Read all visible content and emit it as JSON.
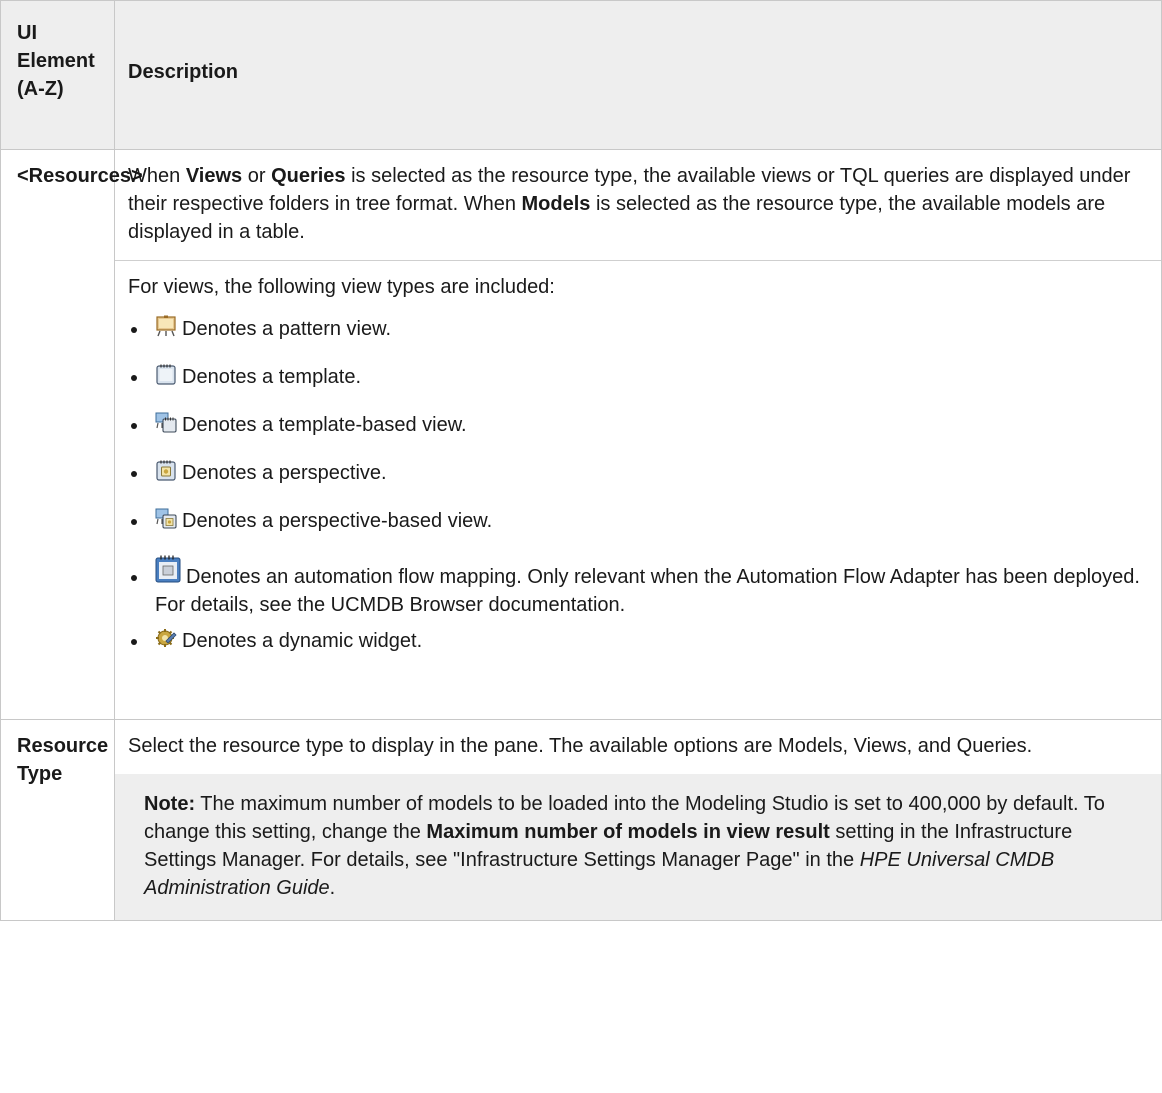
{
  "header": {
    "col1": "UI Element (A-Z)",
    "col2": "Description"
  },
  "rows": [
    {
      "element": "<Resources>",
      "desc_intro": {
        "t1": "When ",
        "b1": "Views",
        "t2": " or ",
        "b2": "Queries",
        "t3": " is selected as the resource type, the available views or TQL queries are displayed under their respective folders in tree format. When ",
        "b3": "Models",
        "t4": " is selected as the resource type, the available models are displayed in a table."
      },
      "desc_types_intro": "For views, the following view types are included:",
      "view_types": [
        {
          "icon": "pattern-view-icon",
          "text": "Denotes a pattern view."
        },
        {
          "icon": "template-icon",
          "text": "Denotes a template."
        },
        {
          "icon": "template-based-view-icon",
          "text": "Denotes a template-based view."
        },
        {
          "icon": "perspective-icon",
          "text": "Denotes a perspective."
        },
        {
          "icon": "perspective-based-view-icon",
          "text": "Denotes a perspective-based view."
        },
        {
          "icon": "automation-flow-mapping-icon",
          "text": "Denotes an automation flow mapping. Only relevant when the Automation Flow Adapter has been deployed. For details, see the UCMDB Browser documentation."
        },
        {
          "icon": "dynamic-widget-icon",
          "text": "Denotes a dynamic widget."
        }
      ]
    },
    {
      "element": "Resource Type",
      "desc": "Select the resource type to display in the pane. The available options are Models, Views, and Queries.",
      "note": {
        "label": "Note:",
        "t1": " The maximum number of models to be loaded into the Modeling Studio is set to 400,000 by default. To change this setting, change the ",
        "b1": "Maximum number of models in view result",
        "t2": " setting in the Infrastructure Settings Manager. For details, see \"Infrastructure Settings Manager Page\" in the ",
        "i1": "HPE Universal CMDB Administration Guide",
        "t3": "."
      }
    }
  ],
  "colors": {
    "header_bg": "#eeeeee",
    "border": "#c8c8c8",
    "note_bg": "#eeeeee"
  }
}
